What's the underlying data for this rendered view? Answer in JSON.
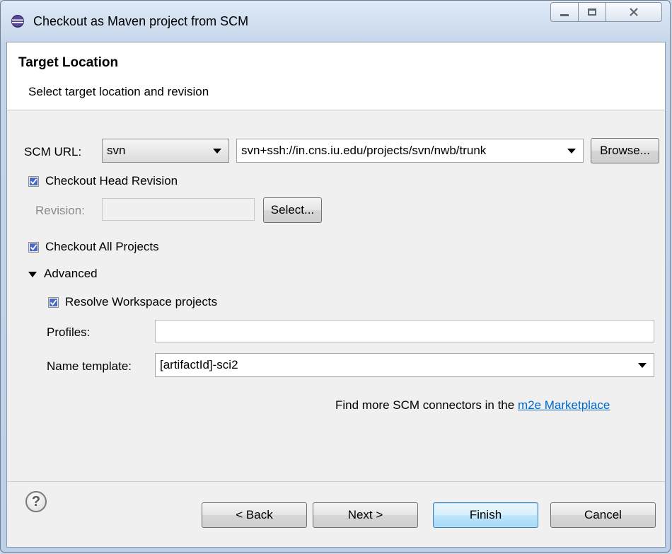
{
  "window": {
    "title": "Checkout as Maven project from SCM"
  },
  "header": {
    "title": "Target Location",
    "description": "Select target location and revision"
  },
  "scm": {
    "label": "SCM URL:",
    "type_value": "svn",
    "url_value": "svn+ssh://in.cns.iu.edu/projects/svn/nwb/trunk",
    "browse_label": "Browse..."
  },
  "revision": {
    "head_label": "Checkout Head Revision",
    "head_checked": true,
    "revision_label": "Revision:",
    "revision_value": "",
    "select_label": "Select..."
  },
  "projects": {
    "all_label": "Checkout All Projects",
    "all_checked": true
  },
  "advanced": {
    "label": "Advanced",
    "resolve_label": "Resolve Workspace projects",
    "resolve_checked": true,
    "profiles_label": "Profiles:",
    "profiles_value": "",
    "name_template_label": "Name template:",
    "name_template_value": "[artifactId]-sci2"
  },
  "marketplace": {
    "text": "Find more SCM connectors in the",
    "link": "m2e Marketplace"
  },
  "footer": {
    "back": "< Back",
    "next": "Next >",
    "finish": "Finish",
    "cancel": "Cancel"
  },
  "colors": {
    "accent": "#3c7fb1",
    "link": "#0066cc",
    "checkbox": "#4a68c4"
  }
}
